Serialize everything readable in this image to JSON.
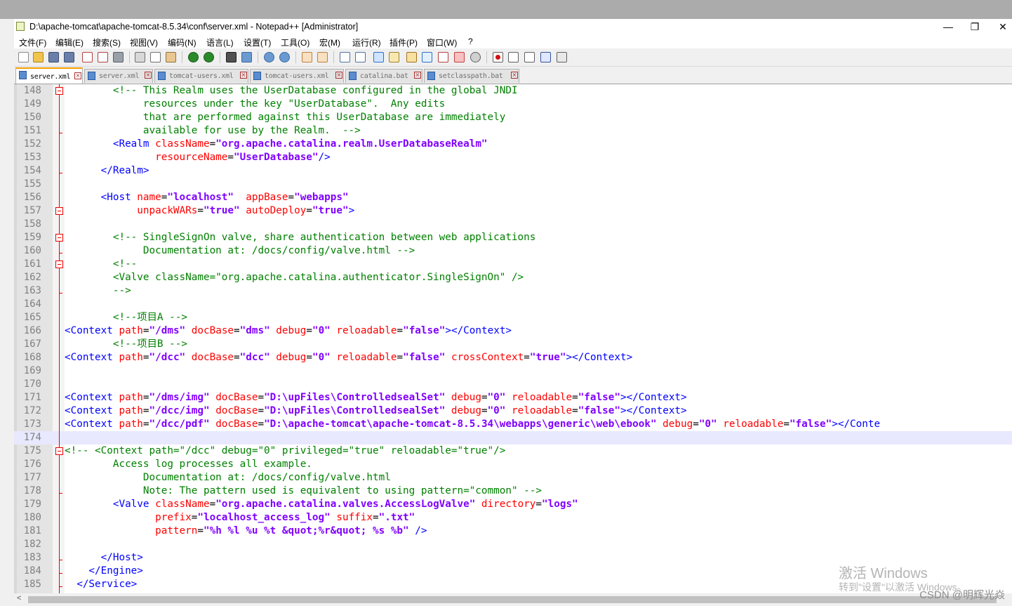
{
  "window": {
    "title": "D:\\apache-tomcat\\apache-tomcat-8.5.34\\conf\\server.xml - Notepad++ [Administrator]",
    "minimize": "—",
    "maximize": "❐",
    "close": "✕"
  },
  "menu": [
    "文件(F)",
    "编辑(E)",
    "搜索(S)",
    "视图(V)",
    "编码(N)",
    "语言(L)",
    "设置(T)",
    "工具(O)",
    "宏(M)",
    "运行(R)",
    "插件(P)",
    "窗口(W)",
    "?"
  ],
  "tabs": [
    {
      "label": "server.xml",
      "active": true
    },
    {
      "label": "server.xml",
      "active": false
    },
    {
      "label": "tomcat-users.xml",
      "active": false
    },
    {
      "label": "tomcat-users.xml",
      "active": false
    },
    {
      "label": "catalina.bat",
      "active": false
    },
    {
      "label": "setclasspath.bat",
      "active": false
    }
  ],
  "editor": {
    "caret_line": 174,
    "lines": [
      {
        "n": "148",
        "s": [
          [
            "c",
            "        <!-- This Realm uses the UserDatabase configured in the global JNDI"
          ]
        ]
      },
      {
        "n": "149",
        "s": [
          [
            "c",
            "             resources under the key \"UserDatabase\".  Any edits"
          ]
        ]
      },
      {
        "n": "150",
        "s": [
          [
            "c",
            "             that are performed against this UserDatabase are immediately"
          ]
        ]
      },
      {
        "n": "151",
        "s": [
          [
            "c",
            "             available for use by the Realm.  -->"
          ]
        ]
      },
      {
        "n": "152",
        "s": [
          [
            "t",
            "        <Realm "
          ],
          [
            "a",
            "className"
          ],
          [
            "p",
            "="
          ],
          [
            "v",
            "\"org.apache.catalina.realm.UserDatabaseRealm\""
          ]
        ]
      },
      {
        "n": "153",
        "s": [
          [
            "a",
            "               resourceName"
          ],
          [
            "p",
            "="
          ],
          [
            "v",
            "\"UserDatabase\""
          ],
          [
            "t",
            "/>"
          ]
        ]
      },
      {
        "n": "154",
        "s": [
          [
            "t",
            "      </Realm>"
          ]
        ]
      },
      {
        "n": "155",
        "s": []
      },
      {
        "n": "156",
        "s": [
          [
            "t",
            "      <Host "
          ],
          [
            "a",
            "name"
          ],
          [
            "p",
            "="
          ],
          [
            "v",
            "\"localhost\""
          ],
          [
            "a",
            "  appBase"
          ],
          [
            "p",
            "="
          ],
          [
            "v",
            "\"webapps\""
          ]
        ]
      },
      {
        "n": "157",
        "s": [
          [
            "a",
            "            unpackWARs"
          ],
          [
            "p",
            "="
          ],
          [
            "v",
            "\"true\""
          ],
          [
            "a",
            " autoDeploy"
          ],
          [
            "p",
            "="
          ],
          [
            "v",
            "\"true\""
          ],
          [
            "t",
            ">"
          ]
        ]
      },
      {
        "n": "158",
        "s": []
      },
      {
        "n": "159",
        "s": [
          [
            "c",
            "        <!-- SingleSignOn valve, share authentication between web applications"
          ]
        ]
      },
      {
        "n": "160",
        "s": [
          [
            "c",
            "             Documentation at: /docs/config/valve.html -->"
          ]
        ]
      },
      {
        "n": "161",
        "s": [
          [
            "c",
            "        <!--"
          ]
        ]
      },
      {
        "n": "162",
        "s": [
          [
            "c",
            "        <Valve className=\"org.apache.catalina.authenticator.SingleSignOn\" />"
          ]
        ]
      },
      {
        "n": "163",
        "s": [
          [
            "c",
            "        -->"
          ]
        ]
      },
      {
        "n": "164",
        "s": []
      },
      {
        "n": "165",
        "s": [
          [
            "c",
            "        <!--项目A -->"
          ]
        ]
      },
      {
        "n": "166",
        "s": [
          [
            "t",
            "<Context "
          ],
          [
            "a",
            "path"
          ],
          [
            "p",
            "="
          ],
          [
            "v",
            "\"/dms\""
          ],
          [
            "a",
            " docBase"
          ],
          [
            "p",
            "="
          ],
          [
            "v",
            "\"dms\""
          ],
          [
            "a",
            " debug"
          ],
          [
            "p",
            "="
          ],
          [
            "v",
            "\"0\""
          ],
          [
            "a",
            " reloadable"
          ],
          [
            "p",
            "="
          ],
          [
            "v",
            "\"false\""
          ],
          [
            "t",
            "></Context>"
          ]
        ]
      },
      {
        "n": "167",
        "s": [
          [
            "c",
            "        <!--项目B -->"
          ]
        ]
      },
      {
        "n": "168",
        "s": [
          [
            "t",
            "<Context "
          ],
          [
            "a",
            "path"
          ],
          [
            "p",
            "="
          ],
          [
            "v",
            "\"/dcc\""
          ],
          [
            "a",
            " docBase"
          ],
          [
            "p",
            "="
          ],
          [
            "v",
            "\"dcc\""
          ],
          [
            "a",
            " debug"
          ],
          [
            "p",
            "="
          ],
          [
            "v",
            "\"0\""
          ],
          [
            "a",
            " reloadable"
          ],
          [
            "p",
            "="
          ],
          [
            "v",
            "\"false\""
          ],
          [
            "a",
            " crossContext"
          ],
          [
            "p",
            "="
          ],
          [
            "v",
            "\"true\""
          ],
          [
            "t",
            "></Context>"
          ]
        ]
      },
      {
        "n": "169",
        "s": []
      },
      {
        "n": "170",
        "s": []
      },
      {
        "n": "171",
        "s": [
          [
            "t",
            "<Context "
          ],
          [
            "a",
            "path"
          ],
          [
            "p",
            "="
          ],
          [
            "v",
            "\"/dms/img\""
          ],
          [
            "a",
            " docBase"
          ],
          [
            "p",
            "="
          ],
          [
            "v",
            "\"D:\\upFiles\\ControlledsealSet\""
          ],
          [
            "a",
            " debug"
          ],
          [
            "p",
            "="
          ],
          [
            "v",
            "\"0\""
          ],
          [
            "a",
            " reloadable"
          ],
          [
            "p",
            "="
          ],
          [
            "v",
            "\"false\""
          ],
          [
            "t",
            "></Context>"
          ]
        ]
      },
      {
        "n": "172",
        "s": [
          [
            "t",
            "<Context "
          ],
          [
            "a",
            "path"
          ],
          [
            "p",
            "="
          ],
          [
            "v",
            "\"/dcc/img\""
          ],
          [
            "a",
            " docBase"
          ],
          [
            "p",
            "="
          ],
          [
            "v",
            "\"D:\\upFiles\\ControlledsealSet\""
          ],
          [
            "a",
            " debug"
          ],
          [
            "p",
            "="
          ],
          [
            "v",
            "\"0\""
          ],
          [
            "a",
            " reloadable"
          ],
          [
            "p",
            "="
          ],
          [
            "v",
            "\"false\""
          ],
          [
            "t",
            "></Context>"
          ]
        ]
      },
      {
        "n": "173",
        "s": [
          [
            "t",
            "<Context "
          ],
          [
            "a",
            "path"
          ],
          [
            "p",
            "="
          ],
          [
            "v",
            "\"/dcc/pdf\""
          ],
          [
            "a",
            " docBase"
          ],
          [
            "p",
            "="
          ],
          [
            "v",
            "\"D:\\apache-tomcat\\apache-tomcat-8.5.34\\webapps\\generic\\web\\ebook\""
          ],
          [
            "a",
            " debug"
          ],
          [
            "p",
            "="
          ],
          [
            "v",
            "\"0\""
          ],
          [
            "a",
            " reloadable"
          ],
          [
            "p",
            "="
          ],
          [
            "v",
            "\"false\""
          ],
          [
            "t",
            "></Conte"
          ]
        ]
      },
      {
        "n": "174",
        "s": []
      },
      {
        "n": "175",
        "s": [
          [
            "c",
            "<!-- <Context path=\"/dcc\" debug=\"0\" privileged=\"true\" reloadable=\"true\"/>"
          ]
        ]
      },
      {
        "n": "176",
        "s": [
          [
            "c",
            "        Access log processes all example."
          ]
        ]
      },
      {
        "n": "177",
        "s": [
          [
            "c",
            "             Documentation at: /docs/config/valve.html"
          ]
        ]
      },
      {
        "n": "178",
        "s": [
          [
            "c",
            "             Note: The pattern used is equivalent to using pattern=\"common\" -->"
          ]
        ]
      },
      {
        "n": "179",
        "s": [
          [
            "t",
            "        <Valve "
          ],
          [
            "a",
            "className"
          ],
          [
            "p",
            "="
          ],
          [
            "v",
            "\"org.apache.catalina.valves.AccessLogValve\""
          ],
          [
            "a",
            " directory"
          ],
          [
            "p",
            "="
          ],
          [
            "v",
            "\"logs\""
          ]
        ]
      },
      {
        "n": "180",
        "s": [
          [
            "a",
            "               prefix"
          ],
          [
            "p",
            "="
          ],
          [
            "v",
            "\"localhost_access_log\""
          ],
          [
            "a",
            " suffix"
          ],
          [
            "p",
            "="
          ],
          [
            "v",
            "\".txt\""
          ]
        ]
      },
      {
        "n": "181",
        "s": [
          [
            "a",
            "               pattern"
          ],
          [
            "p",
            "="
          ],
          [
            "v",
            "\"%h %l %u %t &quot;%r&quot; %s %b\""
          ],
          [
            "t",
            " />"
          ]
        ]
      },
      {
        "n": "182",
        "s": []
      },
      {
        "n": "183",
        "s": [
          [
            "t",
            "      </Host>"
          ]
        ]
      },
      {
        "n": "184",
        "s": [
          [
            "t",
            "    </Engine>"
          ]
        ]
      },
      {
        "n": "185",
        "s": [
          [
            "t",
            "  </Service>"
          ]
        ]
      }
    ]
  },
  "watermark": {
    "line1": "激活 Windows",
    "line2": "转到\"设置\"以激活 Windows。",
    "credit": "CSDN @明辉光焱"
  },
  "colors": {
    "comment": "#008000",
    "tag": "#0000ff",
    "attribute": "#ff0000",
    "value": "#8000ff",
    "fold_marker": "#ee0000",
    "caret_line": "#e8e8ff",
    "tab_accent": "#f4a000"
  }
}
